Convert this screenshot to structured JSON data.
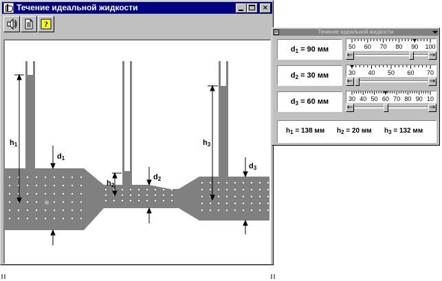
{
  "window": {
    "title": "Течение идеальной жидкости",
    "buttons": {
      "minimize": "_",
      "maximize": "□",
      "close": "×"
    }
  },
  "toolbar": {
    "buttons": [
      {
        "name": "sound",
        "icon": "speaker-icon"
      },
      {
        "name": "document",
        "icon": "document-icon"
      },
      {
        "name": "help",
        "icon": "help-icon",
        "label": "?"
      }
    ]
  },
  "diagram": {
    "labels": {
      "h1": "h",
      "h2": "h",
      "h3": "h",
      "d1": "d",
      "d2": "d",
      "d3": "d"
    },
    "subs": {
      "one": "1",
      "two": "2",
      "three": "3"
    },
    "fluid_color": "#808080",
    "dot_color": "#ffffff"
  },
  "panel": {
    "title": "Течение идеальной жидкости",
    "d1": {
      "label": "d",
      "sub": "1",
      "value": "= 90 мм",
      "scale_labels": [
        "50",
        "60",
        "70",
        "80",
        "90",
        "100"
      ],
      "scale_min": 50,
      "scale_max": 100,
      "current": 90
    },
    "d2": {
      "label": "d",
      "sub": "2",
      "value": "= 30 мм",
      "scale_labels": [
        "30",
        "40",
        "50",
        "60",
        "70"
      ],
      "scale_min": 30,
      "scale_max": 70,
      "current": 30
    },
    "d3": {
      "label": "d",
      "sub": "3",
      "value": "= 60 мм",
      "scale_labels": [
        "30",
        "40",
        "50",
        "60",
        "70",
        "80",
        "90",
        "10"
      ],
      "scale_min": 30,
      "scale_max": 100,
      "current": 60
    },
    "heights": [
      {
        "label": "h",
        "sub": "1",
        "value": "= 138 мм"
      },
      {
        "label": "h",
        "sub": "2",
        "value": "= 20 мм"
      },
      {
        "label": "h",
        "sub": "3",
        "value": "= 132 мм"
      }
    ],
    "arrow_left": "←",
    "arrow_right": "→"
  }
}
